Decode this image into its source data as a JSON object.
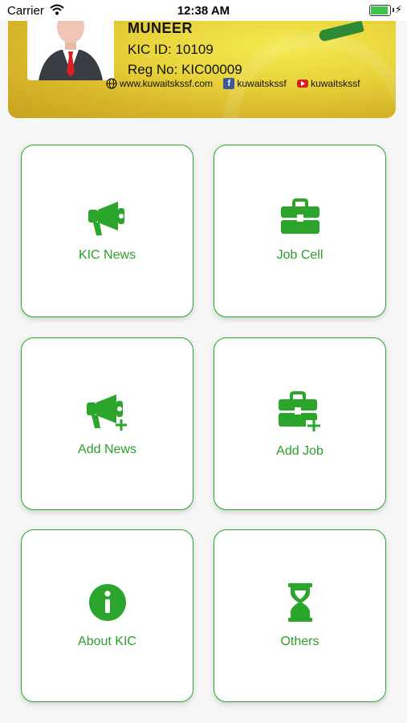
{
  "status_bar": {
    "carrier": "Carrier",
    "time": "12:38 AM"
  },
  "id_card": {
    "name": "MUNEER",
    "kic_id": "KIC ID: 10109",
    "reg_no": "Reg No: KIC00009",
    "website": "www.kuwaitskssf.com",
    "facebook": "kuwaitskssf",
    "youtube": "kuwaitskssf"
  },
  "menu": {
    "kic_news": "KIC News",
    "job_cell": "Job Cell",
    "add_news": "Add News",
    "add_job": "Add Job",
    "about_kic": "About KIC",
    "others": "Others"
  },
  "icons": {
    "kic_news": "megaphone-icon",
    "job_cell": "briefcase-icon",
    "add_news": "megaphone-add-icon",
    "add_job": "briefcase-add-icon",
    "about_kic": "info-icon",
    "others": "hourglass-icon"
  },
  "colors": {
    "accent": "#2ca52c",
    "card_gold": "#e2c635",
    "battery": "#3cc44b"
  }
}
